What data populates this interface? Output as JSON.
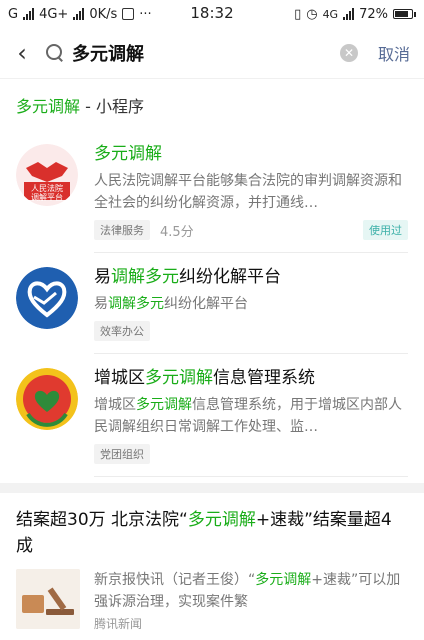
{
  "status_bar": {
    "left": "G",
    "network": "4G+",
    "speed": "0K/s",
    "time": "18:32",
    "network_right": "4G",
    "battery": "72%"
  },
  "search": {
    "query": "多元调解",
    "cancel_label": "取消"
  },
  "section": {
    "keyword": "多元调解",
    "suffix": " - 小程序"
  },
  "apps": [
    {
      "name": "多元调解",
      "logo_text_1": "人民法院",
      "logo_text_2": "调解平台",
      "desc": "人民法院调解平台能够集合法院的审判调解资源和全社会的纠纷化解资源，并打通线…",
      "tag": "法律服务",
      "rating": "4.5分",
      "badge": "使用过"
    },
    {
      "name_pre": "易",
      "name_hl": "调解多元",
      "name_post": "纠纷化解平台",
      "desc_pre": "易",
      "desc_hl": "调解多元",
      "desc_post": "纠纷化解平台",
      "tag": "效率办公"
    },
    {
      "name_pre": "增城区",
      "name_hl": "多元调解",
      "name_post": "信息管理系统",
      "desc_pre": "增城区",
      "desc_hl": "多元调解",
      "desc_post": "信息管理系统，用于增城区内部人民调解组织日常调解工作处理、监…",
      "tag": "党团组织"
    }
  ],
  "news": {
    "title_pre": "结案超30万 北京法院“",
    "title_hl": "多元调解",
    "title_post": "+速裁”结案量超4成",
    "desc_pre": "新京报快讯（记者王俊）“",
    "desc_hl": "多元调解",
    "desc_post": "+速裁”可以加强诉源治理，实现案件繁",
    "source": "腾讯新闻"
  },
  "colors": {
    "highlight": "#1aad19",
    "link": "#576b95"
  }
}
